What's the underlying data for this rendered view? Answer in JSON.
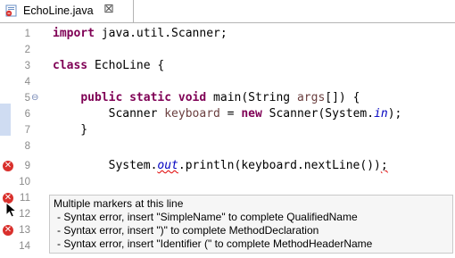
{
  "tab": {
    "filename": "EchoLine.java",
    "close_glyph": "⛝"
  },
  "editor": {
    "lines": [
      {
        "num": "1",
        "text": "import java.util.Scanner;"
      },
      {
        "num": "2",
        "text": ""
      },
      {
        "num": "3",
        "text": "class EchoLine {"
      },
      {
        "num": "4",
        "text": ""
      },
      {
        "num": "5",
        "text": "    public static void main(String args[]) {"
      },
      {
        "num": "6",
        "text": "        Scanner keyboard = new Scanner(System.in);"
      },
      {
        "num": "7",
        "text": "    }"
      },
      {
        "num": "8",
        "text": ""
      },
      {
        "num": "9",
        "text": "        System.out.println(keyboard.nextLine());"
      },
      {
        "num": "10",
        "text": ""
      },
      {
        "num": "11",
        "text": ""
      },
      {
        "num": "12",
        "text": ""
      },
      {
        "num": "13",
        "text": ""
      },
      {
        "num": "14",
        "text": ""
      }
    ],
    "error_lines": [
      "9",
      "11",
      "13"
    ]
  },
  "tooltip": {
    "title": "Multiple markers at this line",
    "items": [
      "- Syntax error, insert \"SimpleName\" to complete QualifiedName",
      "- Syntax error, insert \")\" to complete MethodDeclaration",
      "- Syntax error, insert \"Identifier (\" to complete MethodHeaderName"
    ]
  },
  "colors": {
    "keyword": "#7f0055",
    "field": "#0000c0",
    "error": "#d9302c"
  }
}
